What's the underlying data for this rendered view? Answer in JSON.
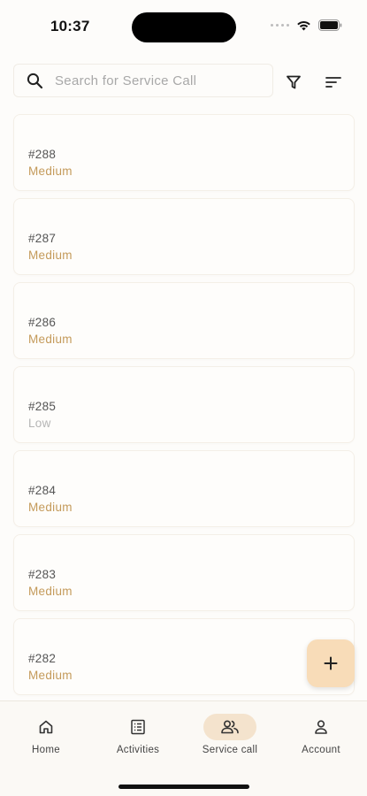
{
  "status_bar": {
    "time": "10:37"
  },
  "search": {
    "placeholder": "Search for Service Call",
    "value": ""
  },
  "icons": {
    "search": "search-icon",
    "filter": "filter-icon",
    "sort": "sort-icon",
    "add": "plus-icon",
    "home": "home-icon",
    "activities": "list-icon",
    "service_call": "people-icon",
    "account": "person-icon"
  },
  "colors": {
    "accent": "#f8dcb8",
    "nav_active": "#f4e3cd",
    "priority_medium": "#c49a5a",
    "priority_low": "#b5b5b5"
  },
  "service_calls": [
    {
      "id": "#288",
      "priority": "Medium"
    },
    {
      "id": "#287",
      "priority": "Medium"
    },
    {
      "id": "#286",
      "priority": "Medium"
    },
    {
      "id": "#285",
      "priority": "Low"
    },
    {
      "id": "#284",
      "priority": "Medium"
    },
    {
      "id": "#283",
      "priority": "Medium"
    },
    {
      "id": "#282",
      "priority": "Medium"
    }
  ],
  "nav": {
    "items": [
      {
        "label": "Home",
        "active": false
      },
      {
        "label": "Activities",
        "active": false
      },
      {
        "label": "Service call",
        "active": true
      },
      {
        "label": "Account",
        "active": false
      }
    ]
  }
}
